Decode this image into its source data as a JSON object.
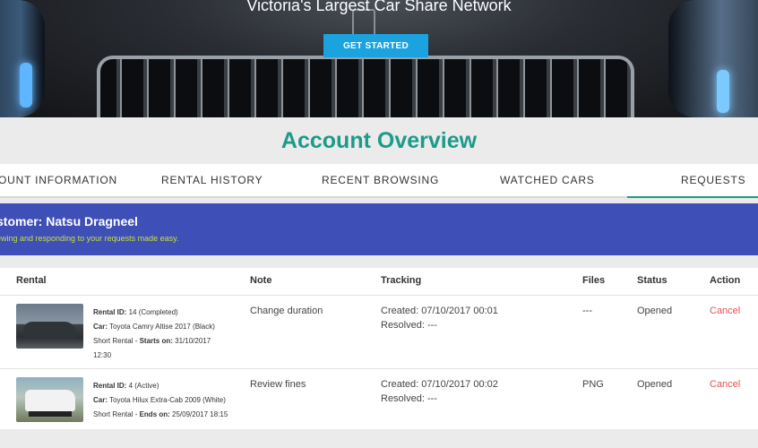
{
  "hero": {
    "tagline": "Victoria's Largest Car Share Network",
    "cta_label": "GET STARTED"
  },
  "page_title": "Account Overview",
  "tabs": [
    {
      "label": "OUNT INFORMATION"
    },
    {
      "label": "RENTAL HISTORY"
    },
    {
      "label": "RECENT BROWSING"
    },
    {
      "label": "WATCHED CARS"
    },
    {
      "label": "REQUESTS"
    }
  ],
  "customer": {
    "name_text": "stomer: Natsu Dragneel",
    "subtitle": "ewing and responding to your requests made easy."
  },
  "table": {
    "headers": {
      "rental": "Rental",
      "note": "Note",
      "tracking": "Tracking",
      "files": "Files",
      "status": "Status",
      "action": "Action"
    },
    "rows": [
      {
        "id_label": "Rental ID:",
        "id_value": "14 (Completed)",
        "car_label": "Car:",
        "car_value": "Toyota Camry Altise 2017 (Black)",
        "type_label": "Short Rental - ",
        "date_label": "Starts on:",
        "date_value": "31/10/2017",
        "time_value": "12:30",
        "note": "Change duration",
        "created": "Created: 07/10/2017 00:01",
        "resolved": "Resolved: ---",
        "files": "---",
        "status": "Opened",
        "action": "Cancel"
      },
      {
        "id_label": "Rental ID:",
        "id_value": "4 (Active)",
        "car_label": "Car:",
        "car_value": "Toyota Hilux Extra-Cab 2009 (White)",
        "type_label": "Short Rental - ",
        "date_label": "Ends on:",
        "date_value": "25/09/2017 18:15",
        "note": "Review fines",
        "created": "Created: 07/10/2017 00:02",
        "resolved": "Resolved: ---",
        "files": "PNG",
        "status": "Opened",
        "action": "Cancel"
      }
    ]
  },
  "colors": {
    "accent_teal": "#1b9b8a",
    "customer_band": "#3f4fb8",
    "subtitle_green": "#c9df3c",
    "cta_blue": "#1aa3de",
    "cancel_red": "#e05252"
  }
}
